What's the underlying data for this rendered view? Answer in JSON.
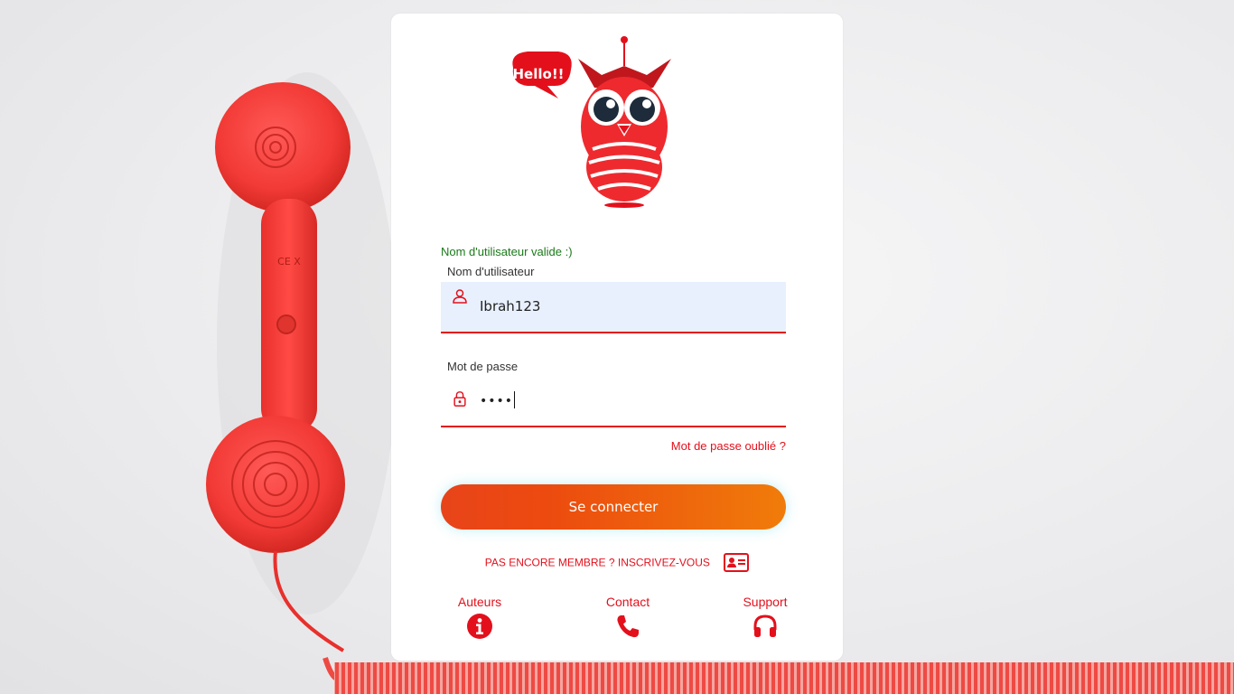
{
  "form": {
    "validation_message": "Nom d'utilisateur valide :)",
    "username_label": "Nom d'utilisateur",
    "username_value": "Ibrah123",
    "password_label": "Mot de passe",
    "password_masked": "••••",
    "forgot_password": "Mot de passe oublié ?",
    "login_button": "Se connecter",
    "signup_prompt": "PAS ENCORE MEMBRE ? INSCRIVEZ-VOUS"
  },
  "logo": {
    "speech_bubble": "Hello!!"
  },
  "footer": {
    "links": [
      {
        "label": "Auteurs",
        "icon": "info-icon"
      },
      {
        "label": "Contact",
        "icon": "phone-icon"
      },
      {
        "label": "Support",
        "icon": "headset-icon"
      }
    ]
  },
  "colors": {
    "accent": "#e3101c",
    "success": "#1a7a1a",
    "button_gradient_start": "#e8441a",
    "button_gradient_end": "#f07c0a",
    "autofill_background": "#e8f0fe"
  }
}
